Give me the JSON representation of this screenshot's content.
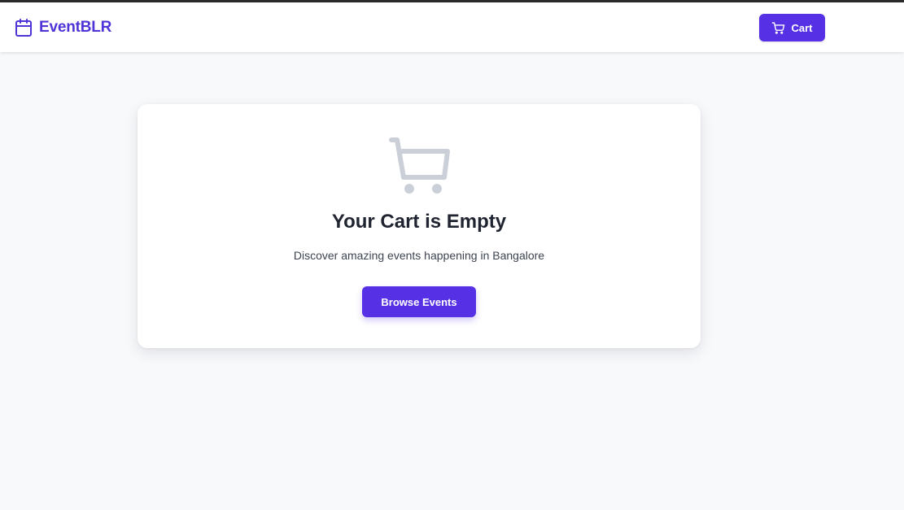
{
  "header": {
    "brand_name": "EventBLR",
    "brand_icon": "calendar-icon",
    "cart_label": "Cart",
    "cart_icon": "shopping-cart-icon"
  },
  "empty_state": {
    "icon": "shopping-cart-icon",
    "title": "Your Cart is Empty",
    "subtitle": "Discover amazing events happening in Bangalore",
    "cta_label": "Browse Events"
  },
  "colors": {
    "brand": "#4f35d8",
    "primary_button": "#5530e4",
    "page_background": "#f8f9fb",
    "card_background": "#ffffff",
    "title_text": "#1f2430",
    "body_text": "#3d4451",
    "muted_icon": "#cbd0d8"
  }
}
